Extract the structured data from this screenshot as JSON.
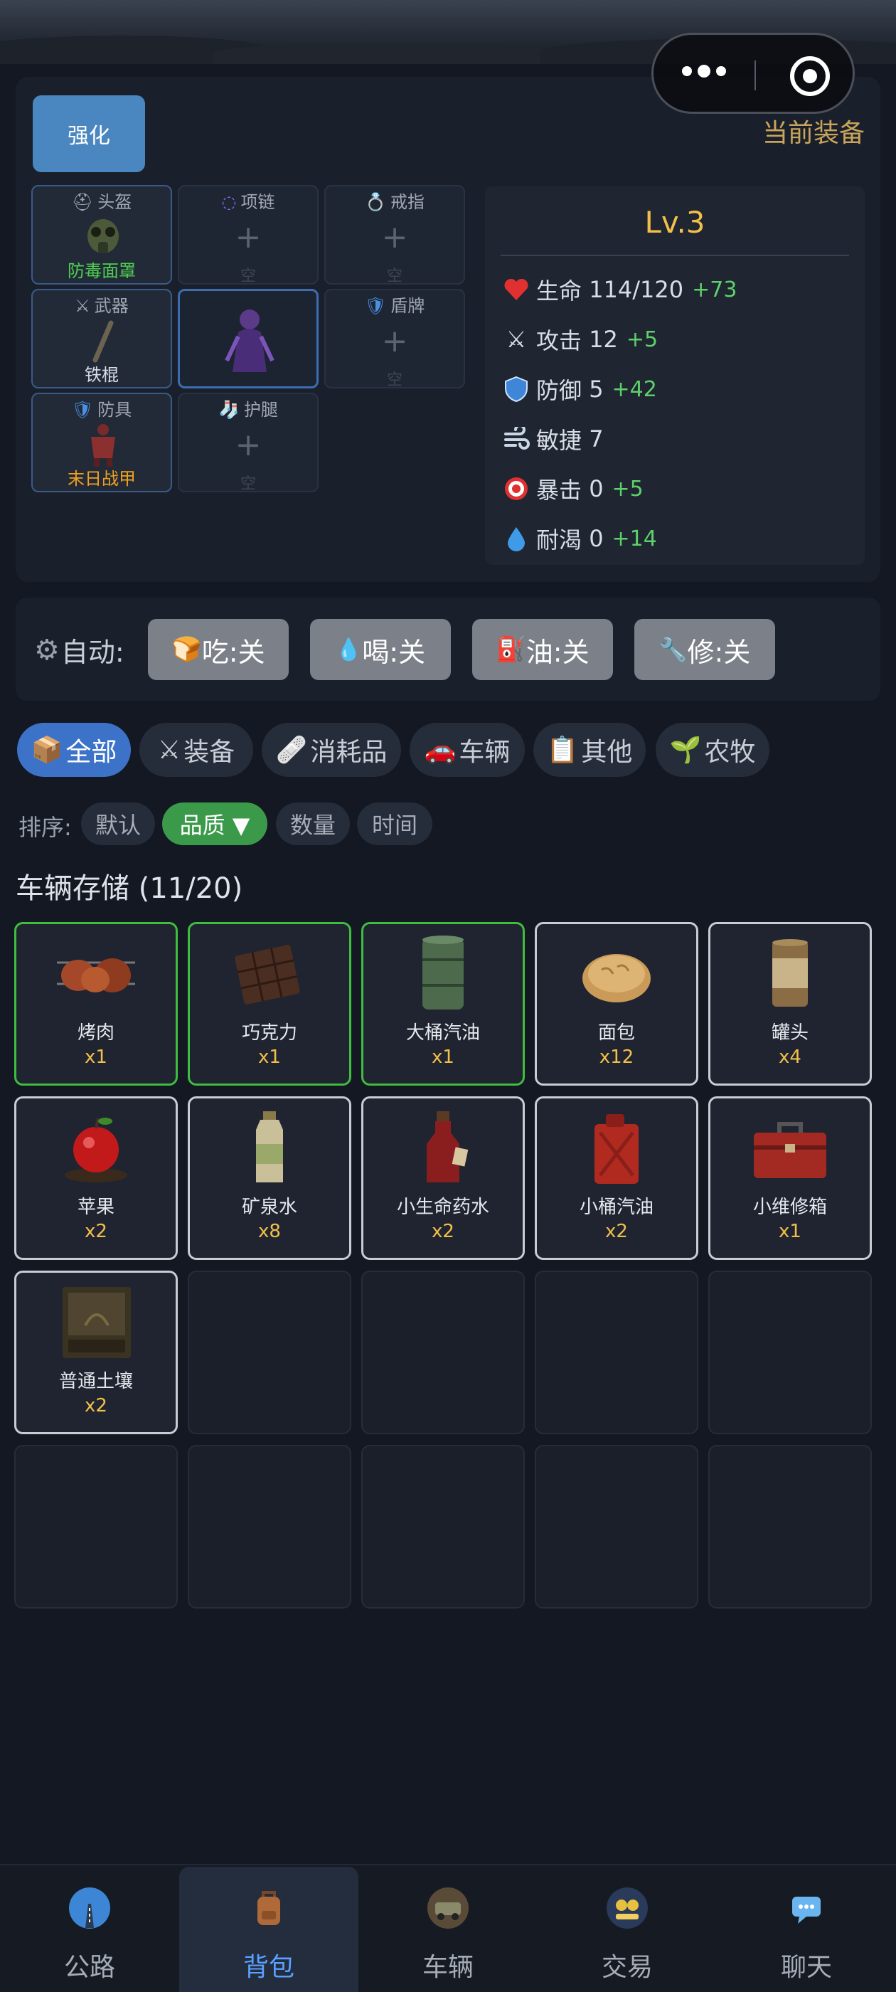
{
  "equipment": {
    "enhance_label": "强化",
    "current_label": "当前装备",
    "slots": {
      "helmet": {
        "title": "头盔",
        "item": "防毒面罩",
        "item_color": "#4fd04f"
      },
      "necklace": {
        "title": "项链",
        "empty": "空"
      },
      "ring": {
        "title": "戒指",
        "empty": "空"
      },
      "weapon": {
        "title": "武器",
        "item": "铁棍",
        "item_color": "#d8dde6"
      },
      "shield": {
        "title": "盾牌",
        "empty": "空"
      },
      "armor": {
        "title": "防具",
        "item": "末日战甲",
        "item_color": "#f0a020"
      },
      "leggings": {
        "title": "护腿",
        "empty": "空"
      }
    },
    "plus": "+"
  },
  "stats": {
    "level": "Lv.3",
    "rows": [
      {
        "label": "生命",
        "value": "114/120",
        "bonus": "+73",
        "icon": "heart-icon"
      },
      {
        "label": "攻击",
        "value": "12",
        "bonus": "+5",
        "icon": "swords-icon"
      },
      {
        "label": "防御",
        "value": "5",
        "bonus": "+42",
        "icon": "shield-icon"
      },
      {
        "label": "敏捷",
        "value": "7",
        "bonus": "",
        "icon": "wind-icon"
      },
      {
        "label": "暴击",
        "value": "0",
        "bonus": "+5",
        "icon": "target-icon"
      },
      {
        "label": "耐渴",
        "value": "0",
        "bonus": "+14",
        "icon": "droplet-icon"
      }
    ]
  },
  "auto": {
    "label": "自动:",
    "buttons": [
      {
        "label": "吃:关",
        "icon": "bread-icon"
      },
      {
        "label": "喝:关",
        "icon": "droplet-icon"
      },
      {
        "label": "油:关",
        "icon": "fuel-icon"
      },
      {
        "label": "修:关",
        "icon": "wrench-icon"
      }
    ]
  },
  "tabs": [
    {
      "label": "全部",
      "icon": "box-icon",
      "active": true
    },
    {
      "label": "装备",
      "icon": "swords-icon",
      "active": false
    },
    {
      "label": "消耗品",
      "icon": "bandage-icon",
      "active": false
    },
    {
      "label": "车辆",
      "icon": "car-icon",
      "active": false
    },
    {
      "label": "其他",
      "icon": "clipboard-icon",
      "active": false
    },
    {
      "label": "农牧",
      "icon": "sprout-icon",
      "active": false
    }
  ],
  "sort": {
    "label": "排序:",
    "options": [
      {
        "label": "默认",
        "active": false
      },
      {
        "label": "品质 ▼",
        "active": true
      },
      {
        "label": "数量",
        "active": false
      },
      {
        "label": "时间",
        "active": false
      }
    ]
  },
  "storage": {
    "title": "车辆存储 (11/20)",
    "items": [
      {
        "name": "烤肉",
        "qty": "x1",
        "rarity": "green",
        "icon": "grilled-meat-icon"
      },
      {
        "name": "巧克力",
        "qty": "x1",
        "rarity": "green",
        "icon": "chocolate-icon"
      },
      {
        "name": "大桶汽油",
        "qty": "x1",
        "rarity": "green",
        "icon": "fuel-barrel-icon"
      },
      {
        "name": "面包",
        "qty": "x12",
        "rarity": "white",
        "icon": "bread-icon"
      },
      {
        "name": "罐头",
        "qty": "x4",
        "rarity": "white",
        "icon": "can-icon"
      },
      {
        "name": "苹果",
        "qty": "x2",
        "rarity": "white",
        "icon": "apple-icon"
      },
      {
        "name": "矿泉水",
        "qty": "x8",
        "rarity": "white",
        "icon": "water-bottle-icon"
      },
      {
        "name": "小生命药水",
        "qty": "x2",
        "rarity": "white",
        "icon": "potion-icon"
      },
      {
        "name": "小桶汽油",
        "qty": "x2",
        "rarity": "white",
        "icon": "jerrycan-icon"
      },
      {
        "name": "小维修箱",
        "qty": "x1",
        "rarity": "white",
        "icon": "toolbox-icon"
      },
      {
        "name": "普通土壤",
        "qty": "x2",
        "rarity": "white",
        "icon": "soil-icon"
      }
    ]
  },
  "nav": [
    {
      "label": "公路",
      "icon": "road-icon",
      "active": false
    },
    {
      "label": "背包",
      "icon": "backpack-icon",
      "active": true
    },
    {
      "label": "车辆",
      "icon": "vehicle-icon",
      "active": false
    },
    {
      "label": "交易",
      "icon": "trade-icon",
      "active": false
    },
    {
      "label": "聊天",
      "icon": "chat-icon",
      "active": false
    }
  ],
  "colors": {
    "accent_blue": "#3c73c9",
    "bonus_green": "#5ed06a",
    "level_gold": "#f2c04a",
    "rare_green": "#3fbd3f"
  }
}
